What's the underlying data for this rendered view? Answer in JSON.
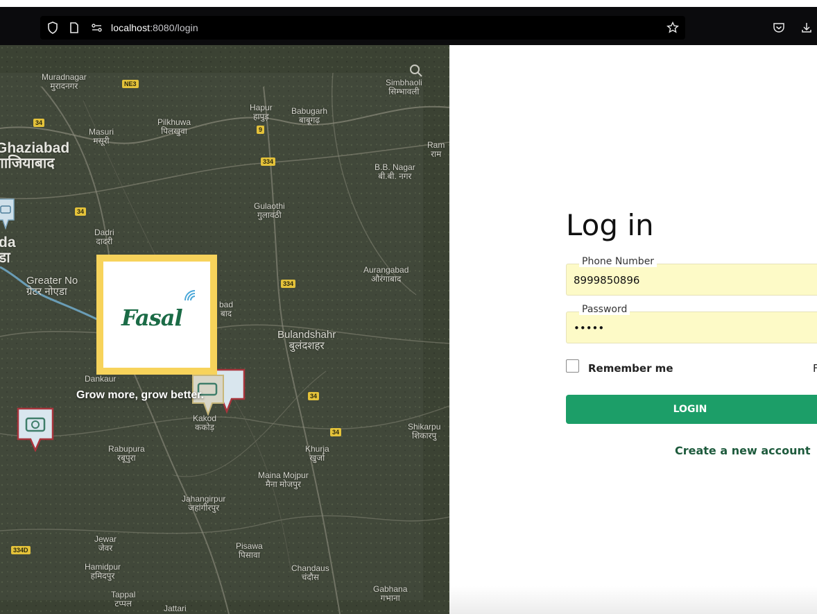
{
  "browser": {
    "url_host": "localhost",
    "url_path": ":8080/login"
  },
  "map": {
    "places": [
      {
        "name": "Muradnagar",
        "local": "मुरादनगर"
      },
      {
        "name": "Simbhaoli",
        "local": "सिम्भावली"
      },
      {
        "name": "Hapur",
        "local": "हापुड़"
      },
      {
        "name": "Babugarh",
        "local": "बाबूगढ़"
      },
      {
        "name": "Pilkhuwa",
        "local": "पिलखुवा"
      },
      {
        "name": "Masuri",
        "local": "मसूरी"
      },
      {
        "name": "Ghaziabad",
        "local": "गाजियाबाद"
      },
      {
        "name": "Ram",
        "local": "राम"
      },
      {
        "name": "B.B. Nagar",
        "local": "बी.बी. नगर"
      },
      {
        "name": "Gulaothi",
        "local": "गुलावठी"
      },
      {
        "name": "Dadri",
        "local": "दादरी"
      },
      {
        "name": "da",
        "local": "डा"
      },
      {
        "name": "Greater No",
        "local": "ग्रेटर नोएडा"
      },
      {
        "name": "Aurangabad",
        "local": "औरंगाबाद"
      },
      {
        "name": "bad",
        "local": "बाद"
      },
      {
        "name": "Bulandshahr",
        "local": "बुलंदशहर"
      },
      {
        "name": "Dankaur",
        "local": ""
      },
      {
        "name": "Kakod",
        "local": "ककोड़"
      },
      {
        "name": "Shikarpu",
        "local": "शिकारपु"
      },
      {
        "name": "Rabupura",
        "local": "रबूपुरा"
      },
      {
        "name": "Khurja",
        "local": "खुर्जा"
      },
      {
        "name": "Maina Mojpur",
        "local": "मैना मोजपुर"
      },
      {
        "name": "Jahangirpur",
        "local": "जहांगीरपुर"
      },
      {
        "name": "Jewar",
        "local": "जेवर"
      },
      {
        "name": "Pisawa",
        "local": "पिसावा"
      },
      {
        "name": "Hamidpur",
        "local": "हमिदपुर"
      },
      {
        "name": "Chandaus",
        "local": "चंदौस"
      },
      {
        "name": "Tappal",
        "local": "टप्पल"
      },
      {
        "name": "Jattari",
        "local": ""
      },
      {
        "name": "Gabhana",
        "local": "गभाना"
      }
    ],
    "highways": [
      "NE3",
      "34",
      "9",
      "334",
      "34",
      "334",
      "34",
      "34",
      "334D"
    ]
  },
  "brand": {
    "logo_text": "Fasal",
    "tagline": "Grow more, grow better."
  },
  "login": {
    "title": "Log in",
    "phone_label": "Phone Number",
    "phone_value": "8999850896",
    "password_label": "Password",
    "password_value": "•••••",
    "remember_label": "Remember me",
    "forgot_fragment": "F",
    "login_button": "LOGIN",
    "create_account": "Create a new account"
  },
  "colors": {
    "accent": "#1c9e68",
    "logo_border": "#f7d35b",
    "brand_green": "#1b6b46",
    "autofill": "#fdfac7"
  },
  "icons": [
    "shield-icon",
    "page-icon",
    "permissions-icon",
    "bookmark-star-icon",
    "pocket-icon",
    "download-icon",
    "search-icon",
    "camera-marker-icon"
  ]
}
